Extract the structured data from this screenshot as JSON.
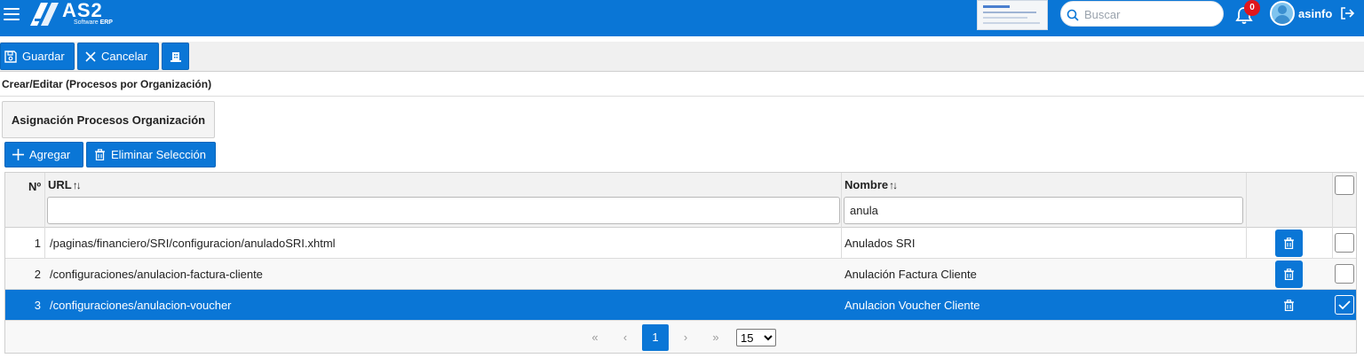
{
  "header": {
    "brand": "AS2",
    "brand_sub": "Software ",
    "brand_sub_bold": "ERP",
    "search_placeholder": "Buscar",
    "notifications_count": "0",
    "username": "asinfo"
  },
  "toolbar": {
    "save_label": "Guardar",
    "cancel_label": "Cancelar"
  },
  "page": {
    "section_title": "Crear/Editar (Procesos por Organización)",
    "tab_label": "Asignación Procesos Organización",
    "add_label": "Agregar",
    "delete_selection_label": "Eliminar Selección"
  },
  "table": {
    "columns": {
      "num": "Nº",
      "url": "URL",
      "nombre": "Nombre"
    },
    "filters": {
      "url": "",
      "nombre": "anula"
    },
    "rows": [
      {
        "num": "1",
        "url": "/paginas/financiero/SRI/configuracion/anuladoSRI.xhtml",
        "nombre": "Anulados SRI",
        "selected": false
      },
      {
        "num": "2",
        "url": "/configuraciones/anulacion-factura-cliente",
        "nombre": "Anulación Factura Cliente",
        "selected": false
      },
      {
        "num": "3",
        "url": "/configuraciones/anulacion-voucher",
        "nombre": "Anulacion Voucher Cliente",
        "selected": true
      }
    ],
    "pager": {
      "first": "«",
      "prev": "‹",
      "current_page": "1",
      "next": "›",
      "last": "»",
      "rows_per_page": "15"
    }
  },
  "colors": {
    "primary": "#0a76d6",
    "badge": "#e0161c"
  },
  "icons": [
    "menu-icon",
    "search-icon",
    "bell-icon",
    "user-avatar-icon",
    "logout-icon",
    "save-icon",
    "close-icon",
    "building-icon",
    "plus-icon",
    "trash-icon",
    "check-icon",
    "sort-icon"
  ]
}
